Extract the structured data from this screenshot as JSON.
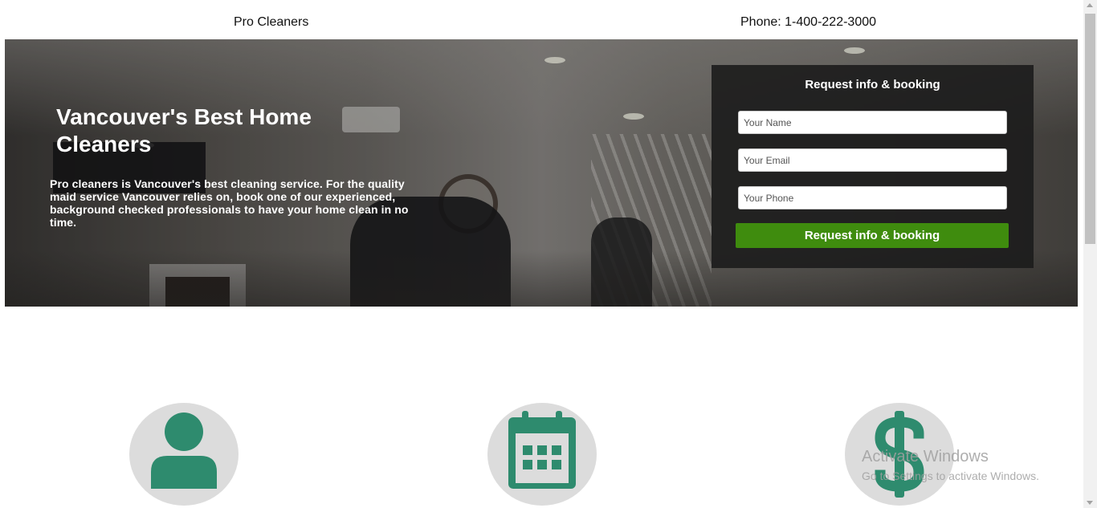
{
  "header": {
    "brand": "Pro Cleaners",
    "phone": "Phone: 1-400-222-3000"
  },
  "hero": {
    "title": "Vancouver's Best Home Cleaners",
    "description": "Pro cleaners is Vancouver's best cleaning service. For the quality maid service Vancouver relies on, book one of our experienced, background checked professionals to have your home clean in no time."
  },
  "form": {
    "title": "Request info & booking",
    "name_placeholder": "Your Name",
    "email_placeholder": "Your Email",
    "phone_placeholder": "Your Phone",
    "submit_label": "Request info & booking"
  },
  "features": {
    "icons": [
      "user-icon",
      "calendar-icon",
      "dollar-icon"
    ]
  },
  "watermark": {
    "title": "Activate Windows",
    "subtitle": "Go to Settings to activate Windows."
  },
  "colors": {
    "accent_green": "#3f8c0e",
    "icon_teal": "#2e8b6e",
    "icon_circle": "#dcdcdc",
    "form_background": "#1c1c1c"
  }
}
